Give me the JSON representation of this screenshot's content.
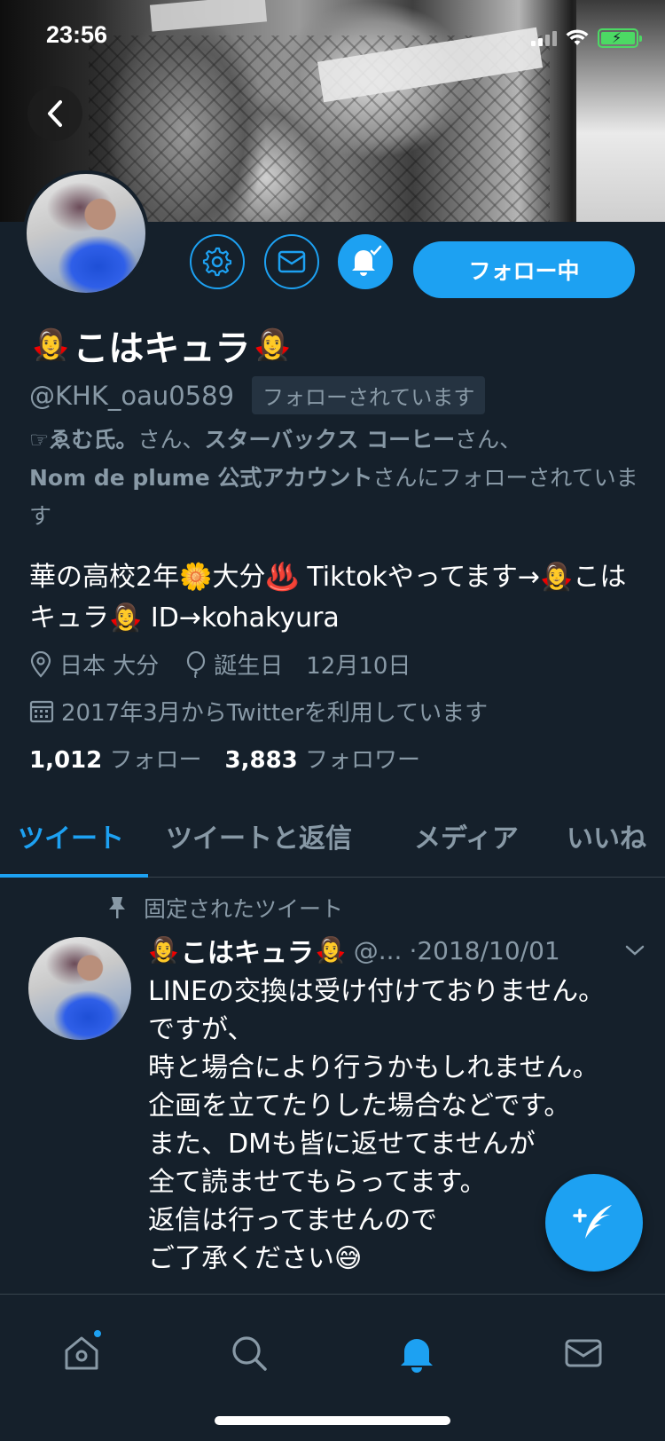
{
  "status_bar": {
    "time": "23:56"
  },
  "profile": {
    "name_emoji_left": "🧛‍♀️",
    "name": "こはキュラ",
    "name_emoji_right": "🧛‍♀️",
    "handle": "@KHK_oau0589",
    "follows_you": "フォローされています",
    "followed_by": {
      "prefix": "☞",
      "user1": "ゑむ氏。",
      "suffix1": "さん、",
      "user2": "スターバックス コーヒー",
      "suffix2": "さん、",
      "user3": "Nom de plume 公式アカウント",
      "suffix3": "さんにフォローされています"
    },
    "bio": "華の高校2年🌼大分♨️ Tiktokやってます→🧛‍♀️こはキュラ🧛‍♀️ ID→kohakyura",
    "location": "日本 大分",
    "birthday": "誕生日　12月10日",
    "joined": "2017年3月からTwitterを利用しています",
    "following_count": "1,012",
    "following_label": "フォロー",
    "followers_count": "3,883",
    "followers_label": "フォロワー"
  },
  "actions": {
    "settings_icon": "gear-icon",
    "dm_icon": "mail-icon",
    "notify_icon": "bell-check-icon",
    "follow_label": "フォロー中"
  },
  "tabs": [
    {
      "label": "ツイート",
      "active": true
    },
    {
      "label": "ツイートと返信",
      "active": false
    },
    {
      "label": "メディア",
      "active": false
    },
    {
      "label": "いいね",
      "active": false
    }
  ],
  "pinned_tweet": {
    "pinned_label": "固定されたツイート",
    "author_emoji_left": "🧛‍♀️",
    "author_name": "こはキュラ",
    "author_emoji_right": "🧛‍♀️",
    "author_handle": "@...",
    "date": "·2018/10/01",
    "text": "LINEの交換は受け付けておりません。\nですが、\n時と場合により行うかもしれません。\n企画を立てたりした場合などです。\nまた、DMも皆に返せてませんが\n全て読ませてもらってます。\n返信は行ってませんので\nご了承ください😅"
  },
  "colors": {
    "background": "#15202b",
    "accent": "#1da1f2",
    "secondary_text": "#8899a6",
    "divider": "#38444d"
  },
  "bottom_nav": {
    "items": [
      "home-icon",
      "search-icon",
      "notifications-icon",
      "messages-icon"
    ],
    "active": "notifications-icon"
  }
}
